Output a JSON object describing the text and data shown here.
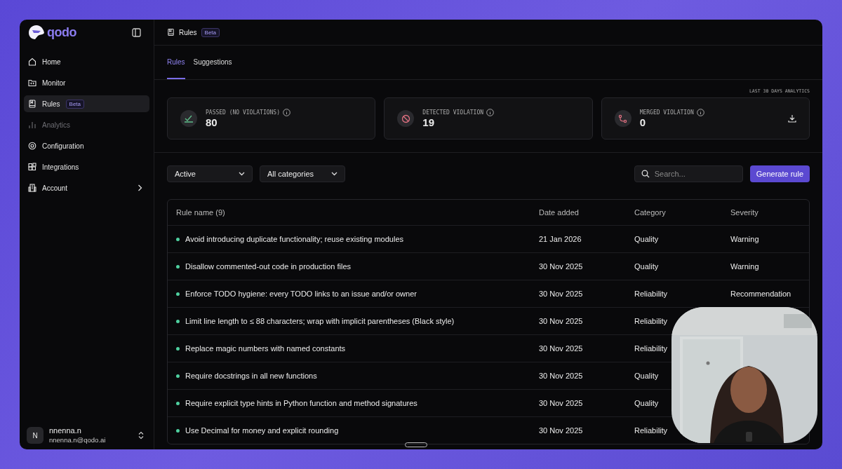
{
  "sidebar": {
    "logo": "qodo",
    "items": [
      {
        "label": "Home",
        "selected": false,
        "disabled": false
      },
      {
        "label": "Monitor",
        "selected": false,
        "disabled": false
      },
      {
        "label": "Rules",
        "selected": true,
        "disabled": false,
        "badge": "Beta"
      },
      {
        "label": "Analytics",
        "selected": false,
        "disabled": true
      },
      {
        "label": "Configuration",
        "selected": false,
        "disabled": false
      },
      {
        "label": "Integrations",
        "selected": false,
        "disabled": false
      },
      {
        "label": "Account",
        "selected": false,
        "disabled": false,
        "submenu": true
      }
    ],
    "user": {
      "initial": "N",
      "name": "nnenna.n",
      "email": "nnenna.n@qodo.ai"
    }
  },
  "header": {
    "title": "Rules",
    "badge": "Beta"
  },
  "tabs": [
    {
      "label": "Rules",
      "selected": true
    },
    {
      "label": "Suggestions",
      "selected": false
    }
  ],
  "analytics_label": "LAST 30 DAYS ANALYTICS",
  "stats": [
    {
      "kind": "passed",
      "label": "PASSED (NO VIOLATIONS)",
      "value": "80"
    },
    {
      "kind": "detected",
      "label": "DETECTED VIOLATION",
      "value": "19"
    },
    {
      "kind": "merged",
      "label": "MERGED VIOLATION",
      "value": "0",
      "download": true
    }
  ],
  "filters": [
    {
      "value": "Active"
    },
    {
      "value": "All categories"
    }
  ],
  "search": {
    "placeholder": "Search..."
  },
  "generate_button": "Generate rule",
  "table": {
    "columns": [
      "Rule name (9)",
      "Date added",
      "Category",
      "Severity"
    ],
    "rows": [
      {
        "name": "Avoid introducing duplicate functionality; reuse existing modules",
        "date": "21 Jan 2026",
        "category": "Quality",
        "severity": "Warning"
      },
      {
        "name": "Disallow commented-out code in production files",
        "date": "30 Nov 2025",
        "category": "Quality",
        "severity": "Warning"
      },
      {
        "name": "Enforce TODO hygiene: every TODO links to an issue and/or owner",
        "date": "30 Nov 2025",
        "category": "Reliability",
        "severity": "Recommendation"
      },
      {
        "name": "Limit line length to ≤ 88 characters; wrap with implicit parentheses (Black style)",
        "date": "30 Nov 2025",
        "category": "Reliability"
      },
      {
        "name": "Replace magic numbers with named constants",
        "date": "30 Nov 2025",
        "category": "Reliability"
      },
      {
        "name": "Require docstrings in all new functions",
        "date": "30 Nov 2025",
        "category": "Quality"
      },
      {
        "name": "Require explicit type hints in Python function and method signatures",
        "date": "30 Nov 2025",
        "category": "Quality"
      },
      {
        "name": "Use Decimal for money and explicit rounding",
        "date": "30 Nov 2025",
        "category": "Reliability"
      }
    ]
  }
}
